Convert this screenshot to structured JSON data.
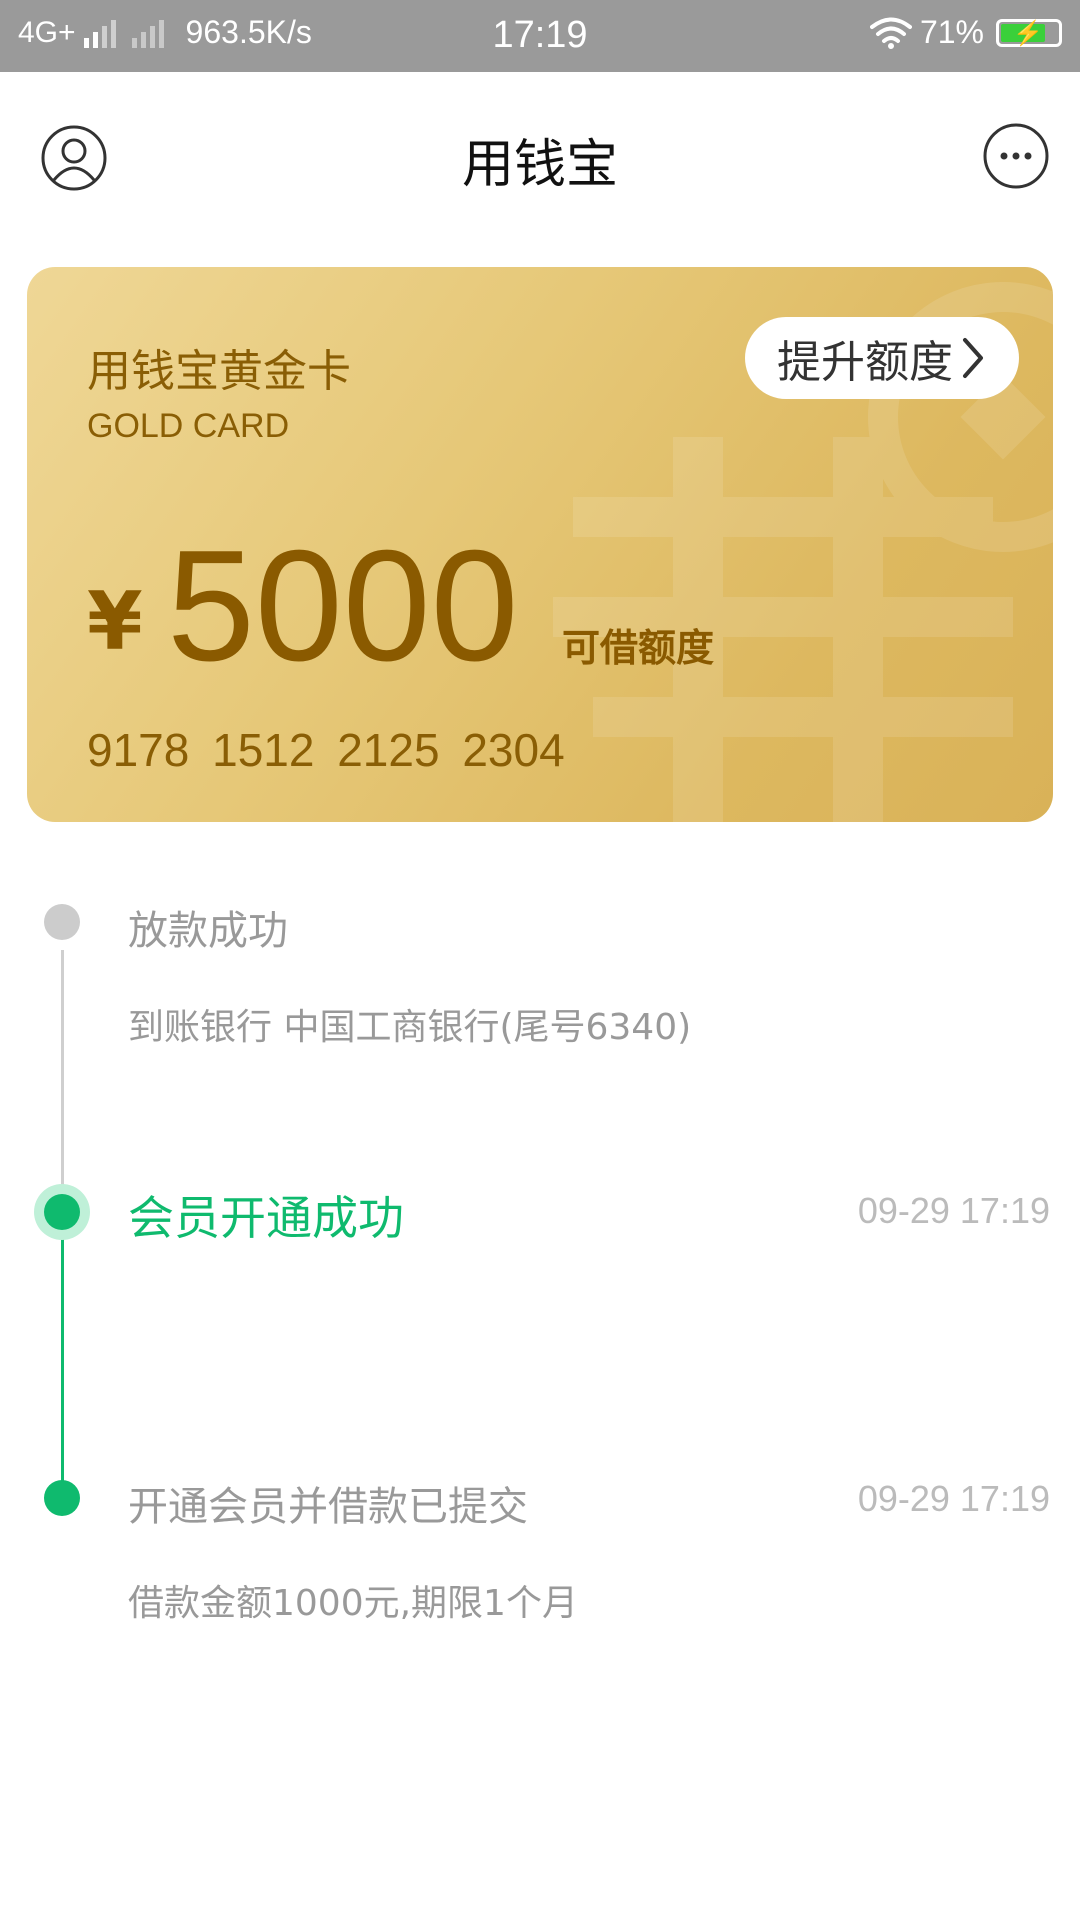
{
  "status_bar": {
    "network": "4G+",
    "speed": "963.5K/s",
    "time": "17:19",
    "battery": "71%"
  },
  "nav": {
    "title": "用钱宝",
    "user_icon": "user-icon",
    "more_icon": "more-icon"
  },
  "card": {
    "title": "用钱宝黄金卡",
    "subtitle": "GOLD CARD",
    "upgrade_label": "提升额度",
    "currency": "¥",
    "amount": "5000",
    "amount_label": "可借额度",
    "card_number": "9178  1512  2125  2304",
    "colors": {
      "text": "#8a5a00",
      "background": "#e6c878"
    }
  },
  "timeline": {
    "items": [
      {
        "title": "放款成功",
        "detail": "到账银行 中国工商银行(尾号6340)",
        "time": ""
      },
      {
        "title": "会员开通成功",
        "detail": "",
        "time": "09-29 17:19"
      },
      {
        "title": "开通会员并借款已提交",
        "detail": "借款金额1000元,期限1个月",
        "time": "09-29 17:19"
      }
    ],
    "colors": {
      "active": "#0fba6e",
      "inactive": "#cccccc"
    }
  }
}
